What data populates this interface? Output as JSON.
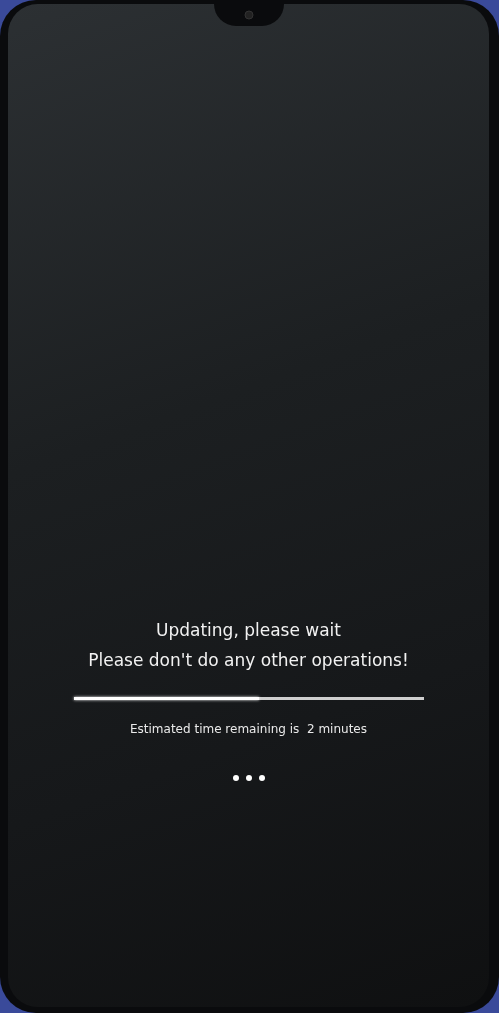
{
  "update_screen": {
    "title": "Updating, please wait",
    "warning": "Please don't do any other operations!",
    "progress": {
      "level": 0.53
    },
    "estimate": "Estimated time remaining is  2 minutes"
  }
}
